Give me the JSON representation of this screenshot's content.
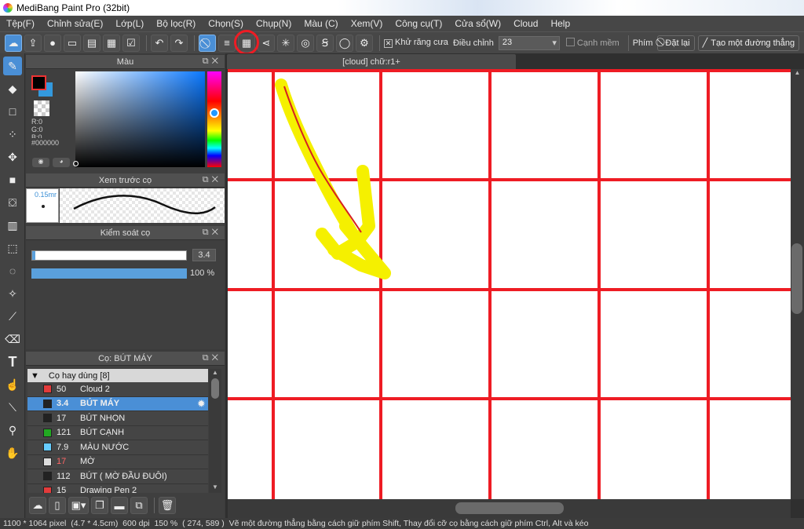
{
  "window": {
    "title": "MediBang Paint Pro (32bit)"
  },
  "menu": [
    "Tệp(F)",
    "Chỉnh sửa(E)",
    "Lớp(L)",
    "Bộ lọc(R)",
    "Chọn(S)",
    "Chụp(N)",
    "Màu (C)",
    "Xem(V)",
    "Công cụ(T)",
    "Cửa sổ(W)",
    "Cloud",
    "Help"
  ],
  "toolbar": {
    "antialias_label": "Khử răng cưa",
    "adjust_label": "Điều chỉnh",
    "adjust_value": "23",
    "soft_edge_label": "Cạnh mềm",
    "key_label": "Phím",
    "reset_label": "Đặt lại",
    "create_line_label": "Tạo một đường thẳng"
  },
  "color_panel": {
    "title": "Màu",
    "r": "R:0",
    "g": "G:0",
    "b": "B:0",
    "hex": "#000000",
    "fg_color": "#000000",
    "bg_color": "#3399dd"
  },
  "brush_preview_panel": {
    "title": "Xem trước cọ",
    "size": "0.15mr"
  },
  "brush_control_panel": {
    "title": "Kiểm soát cọ",
    "size_value": "3.4",
    "opacity_value": "100 %",
    "size_fraction": 0.02,
    "opacity_fraction": 1.0
  },
  "brush_list_panel": {
    "title": "Cọ: BÚT MÁY",
    "group": "Cọ hay dùng [8]",
    "items": [
      {
        "size": "50",
        "name": "Cloud 2",
        "color": "#e33b3b"
      },
      {
        "size": "3.4",
        "name": "BÚT MÁY",
        "color": "#222222",
        "selected": true
      },
      {
        "size": "17",
        "name": "BÚT NHỌN",
        "color": "#222222"
      },
      {
        "size": "121",
        "name": "BÚT CẠNH",
        "color": "#22aa22"
      },
      {
        "size": "7.9",
        "name": "MÀU NƯỚC",
        "color": "#66ccff"
      },
      {
        "size": "17",
        "name": "MỜ",
        "color": "#dddddd"
      },
      {
        "size": "112",
        "name": "BÚT ( MỜ ĐẦU ĐUÔI)",
        "color": "#222222"
      },
      {
        "size": "15",
        "name": "Drawing Pen 2",
        "color": "#e33b3b"
      }
    ]
  },
  "document": {
    "tab_title": "[cloud] chữ:r1+"
  },
  "status": {
    "dimensions": "1100 * 1064 pixel",
    "physical": "(4.7 * 4.5cm)",
    "dpi": "600 dpi",
    "zoom": "150 %",
    "coords": "( 274, 589 )",
    "hint": "Vẽ một đường thẳng bằng cách giữ phím Shift, Thay đổi cỡ cọ bằng cách giữ phím Ctrl, Alt và kéo"
  },
  "colors": {
    "grid_red": "#ee1c24",
    "accent_blue": "#4a8fd6",
    "highlight_yellow": "#f5f000"
  }
}
